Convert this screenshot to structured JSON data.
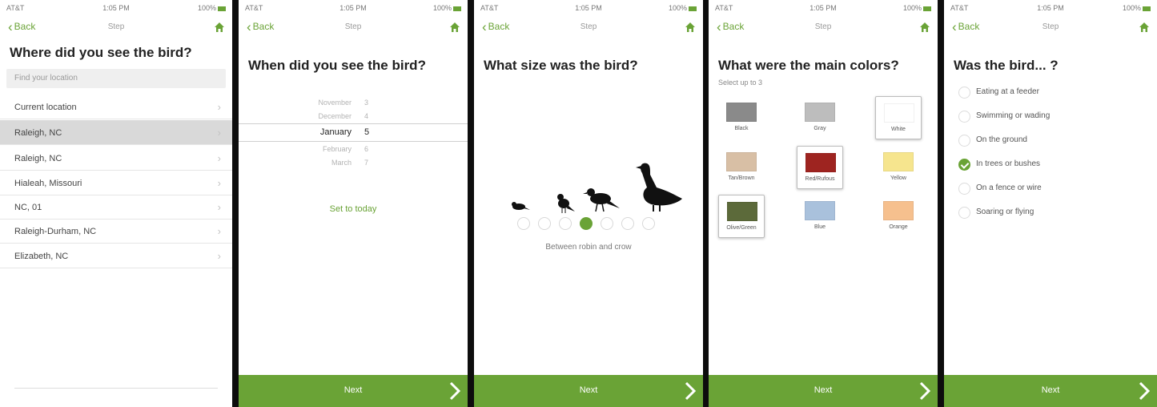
{
  "status": {
    "left": "AT&T",
    "center": "1:05 PM",
    "right": "100%"
  },
  "nav": {
    "back_label": "Back",
    "title": "Step",
    "home_icon": "home-icon"
  },
  "next": {
    "label": "Next",
    "arrow_icon": "chevron-right-icon"
  },
  "accent": "#6aa336",
  "screen1": {
    "question": "Where did you see the bird?",
    "search_placeholder": "Find your location",
    "locations": [
      {
        "label": "Current location",
        "selected": false
      },
      {
        "label": "Raleigh, NC",
        "selected": true
      },
      {
        "label": "Raleigh, NC",
        "selected": false
      },
      {
        "label": "Hialeah, Missouri",
        "selected": false
      },
      {
        "label": "NC, 01",
        "selected": false
      },
      {
        "label": "Raleigh-Durham, NC",
        "selected": false
      },
      {
        "label": "Elizabeth, NC",
        "selected": false
      }
    ]
  },
  "screen2": {
    "question": "When did you see the bird?",
    "picker": [
      {
        "month": "November",
        "day": "3"
      },
      {
        "month": "December",
        "day": "4"
      },
      {
        "month": "January",
        "day": "5",
        "selected": true
      },
      {
        "month": "February",
        "day": "6"
      },
      {
        "month": "March",
        "day": "7"
      }
    ],
    "today_button": "Set to today"
  },
  "screen3": {
    "question": "What size was the bird?",
    "selected_index": 3,
    "dot_count": 7,
    "caption": "Between robin and crow"
  },
  "screen4": {
    "question": "What were the main colors?",
    "hint": "Select up to 3",
    "swatches": [
      {
        "label": "Black",
        "color": "#8a8a8a",
        "selected": false
      },
      {
        "label": "Gray",
        "color": "#bdbdbd",
        "selected": false
      },
      {
        "label": "White",
        "color": "#ffffff",
        "selected": true
      },
      {
        "label": "Tan/Brown",
        "color": "#d8bfa5",
        "selected": false
      },
      {
        "label": "Red/Rufous",
        "color": "#9e2420",
        "selected": true
      },
      {
        "label": "Yellow",
        "color": "#f6e58e",
        "selected": false
      },
      {
        "label": "Olive/Green",
        "color": "#5c6a3a",
        "selected": true
      },
      {
        "label": "Blue",
        "color": "#a9c1dc",
        "selected": false
      },
      {
        "label": "Orange",
        "color": "#f6c08e",
        "selected": false
      }
    ]
  },
  "screen5": {
    "question": "Was the bird... ?",
    "options": [
      {
        "label": "Eating at a feeder",
        "selected": false
      },
      {
        "label": "Swimming or wading",
        "selected": false
      },
      {
        "label": "On the ground",
        "selected": false
      },
      {
        "label": "In trees or bushes",
        "selected": true
      },
      {
        "label": "On a fence or wire",
        "selected": false
      },
      {
        "label": "Soaring or flying",
        "selected": false
      }
    ]
  }
}
